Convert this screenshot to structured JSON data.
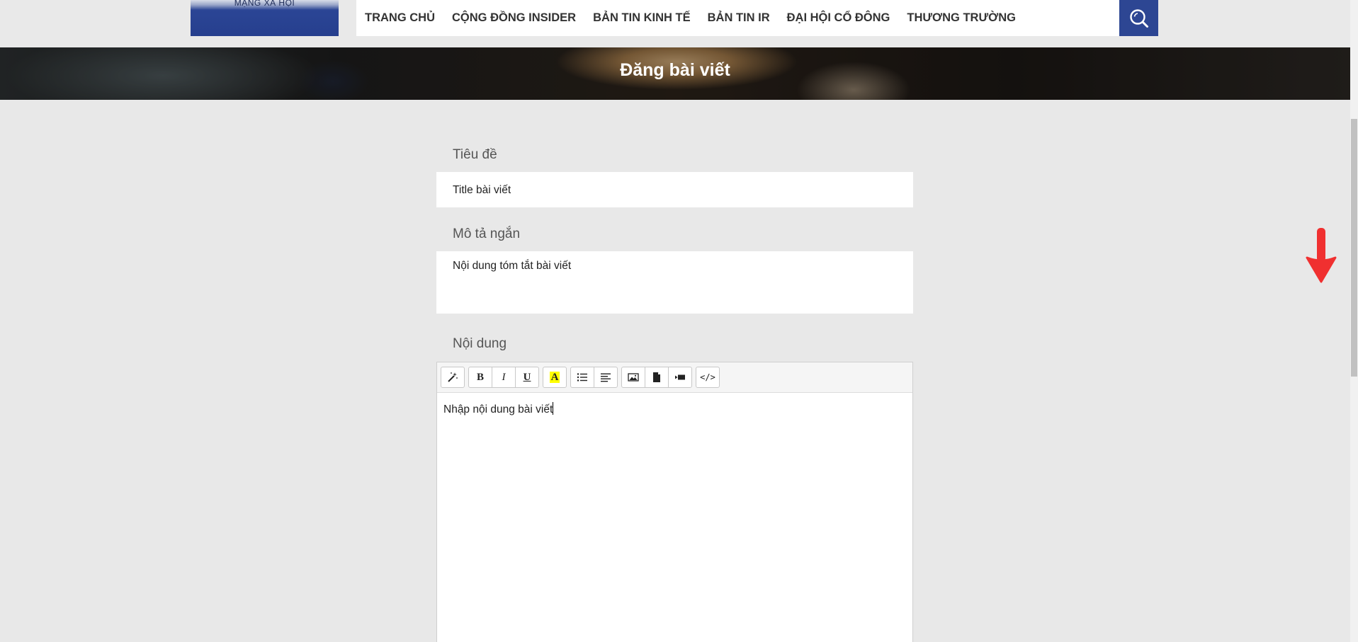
{
  "header": {
    "logo_text": "MẠNG XÃ HỘI",
    "nav": [
      {
        "label": "TRANG CHỦ"
      },
      {
        "label": "CỘNG ĐỒNG INSIDER"
      },
      {
        "label": "BẢN TIN KINH TẾ"
      },
      {
        "label": "BẢN TIN IR"
      },
      {
        "label": "ĐẠI HỘI CỔ ĐÔNG"
      },
      {
        "label": "THƯƠNG TRƯỜNG"
      }
    ],
    "search_icon": "search-icon",
    "brand_color": "#2d4693"
  },
  "banner": {
    "title": "Đăng bài viết"
  },
  "form": {
    "title": {
      "label": "Tiêu đề",
      "value": "Title bài viết"
    },
    "description": {
      "label": "Mô tả ngắn",
      "value": "Nội dung tóm tắt bài viết"
    },
    "content": {
      "label": "Nội dung",
      "value": "Nhập nội dung bài viết",
      "toolbar": [
        [
          "magic-wand-icon"
        ],
        [
          "bold-icon",
          "italic-icon",
          "underline-icon"
        ],
        [
          "text-color-icon"
        ],
        [
          "unordered-list-icon",
          "align-icon"
        ],
        [
          "image-icon",
          "document-icon",
          "video-icon"
        ],
        [
          "code-view-icon"
        ]
      ],
      "toolbar_labels": {
        "bold": "B",
        "italic": "I",
        "underline": "U",
        "text_color": "A",
        "code": "</>"
      }
    }
  },
  "annotation": {
    "arrow_icon": "down-arrow-icon",
    "arrow_color": "#f03030"
  }
}
